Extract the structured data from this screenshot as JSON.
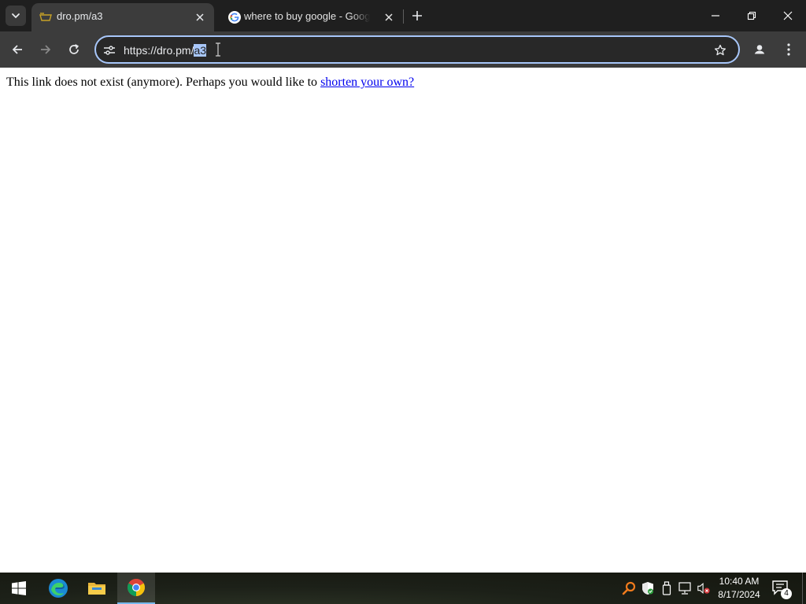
{
  "browser": {
    "tabs": [
      {
        "title": "dro.pm/a3",
        "active": true,
        "favicon": "dropm-favicon-icon"
      },
      {
        "title": "where to buy google - Google Search",
        "active": false,
        "favicon": "google-g-icon"
      }
    ],
    "address_bar": {
      "url_prefix": "https://dro.pm/",
      "url_selected": "a3"
    }
  },
  "page": {
    "message_before": "This link does not exist (anymore). Perhaps you would like to ",
    "link_text": "shorten your own?"
  },
  "taskbar": {
    "apps": [
      "windows-start-icon",
      "edge-icon",
      "file-explorer-icon",
      "chrome-icon"
    ],
    "clock": {
      "time": "10:40 AM",
      "date": "8/17/2024"
    },
    "notification_count": "4"
  },
  "colors": {
    "tab_strip": "#1f1f1f",
    "toolbar": "#3c3c3c",
    "omnibox_focus": "#a8c7fa",
    "link": "#0000ee"
  }
}
